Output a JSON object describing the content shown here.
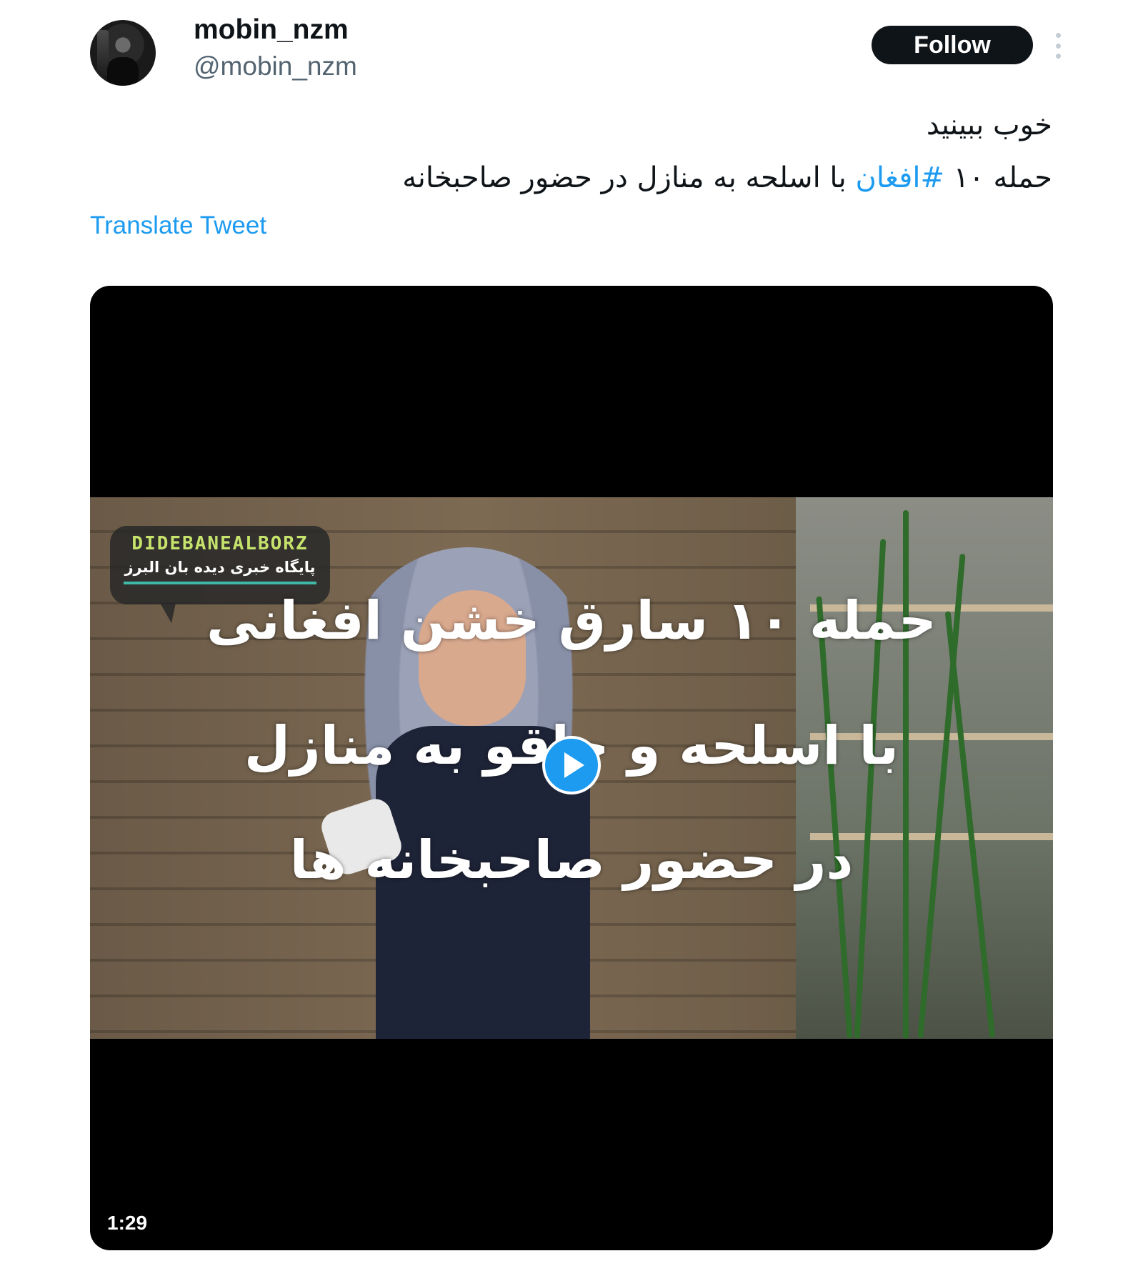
{
  "author": {
    "display_name": "mobin_nzm",
    "handle": "@mobin_nzm"
  },
  "follow_label": "Follow",
  "more_icon": "more-vertical-icon",
  "tweet": {
    "line1": "خوب ببینید",
    "line2_prefix": "حمله ۱۰ ",
    "hashtag": "#افغان",
    "line2_suffix": " با اسلحه به منازل در حضور صاحبخانه"
  },
  "translate_label": "Translate Tweet",
  "video": {
    "logo_en": "DIDEBANEALBORZ",
    "logo_fa": "پایگاه خبری دیده بان البرز",
    "overlay_lines": [
      "حمله ۱۰ سارق خشن افغانی",
      "با اسلحه و چاقو به منازل",
      "در حضور صاحبخانه ها"
    ],
    "duration": "1:29",
    "play_icon": "play-icon"
  },
  "colors": {
    "accent": "#1d9bf0",
    "follow_bg": "#0f1419",
    "handle": "#536471"
  }
}
